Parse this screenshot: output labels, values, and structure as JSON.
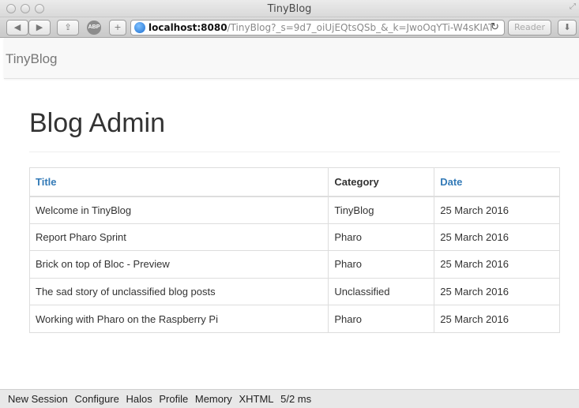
{
  "window": {
    "title": "TinyBlog",
    "url_host": "localhost:8080",
    "url_path": "/TinyBlog?_s=9d7_oiUjEQtsQSb_&_k=JwoOqYTi-W4sKIAT",
    "reader_label": "Reader",
    "abp_label": "ABP"
  },
  "navbar": {
    "brand": "TinyBlog"
  },
  "page": {
    "title": "Blog Admin"
  },
  "table": {
    "headers": [
      "Title",
      "Category",
      "Date"
    ],
    "rows": [
      [
        "Welcome in TinyBlog",
        "TinyBlog",
        "25 March 2016"
      ],
      [
        "Report Pharo Sprint",
        "Pharo",
        "25 March 2016"
      ],
      [
        "Brick on top of Bloc - Preview",
        "Pharo",
        "25 March 2016"
      ],
      [
        "The sad story of unclassified blog posts",
        "Unclassified",
        "25 March 2016"
      ],
      [
        "Working with Pharo on the Raspberry Pi",
        "Pharo",
        "25 March 2016"
      ]
    ]
  },
  "footer": {
    "items": [
      "New Session",
      "Configure",
      "Halos",
      "Profile",
      "Memory",
      "XHTML",
      "5/2 ms"
    ]
  },
  "colors": {
    "link": "#337ab7",
    "navbar_bg": "#f8f8f8",
    "text": "#333333"
  }
}
